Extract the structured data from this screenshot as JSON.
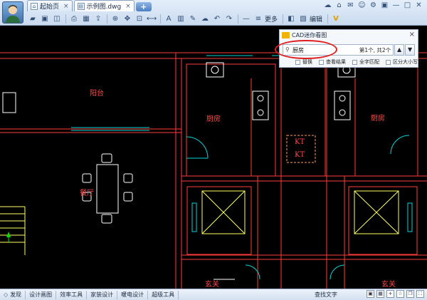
{
  "tabs": [
    {
      "label": "起始页",
      "active": false
    },
    {
      "label": "示例图.dwg",
      "active": true
    }
  ],
  "tab_add_label": "+",
  "window_controls": [
    "☁",
    "⌂",
    "✉",
    "☺",
    "⚙",
    "▣",
    "—",
    "□",
    "✕"
  ],
  "toolbar": {
    "more_label": "更多",
    "edit_label": "编辑"
  },
  "mini_viewer": {
    "title": "CAD迷你看图",
    "close": "×",
    "search_value": "厨房",
    "result_text": "第1个, 共2个",
    "nav_up": "▲",
    "nav_down": "▼",
    "options": [
      "替换",
      "查看结果",
      "全字匹配",
      "区分大小写"
    ]
  },
  "room_labels": {
    "balcony": "阳台",
    "kitchen_left": "厨房",
    "kitchen_right": "厨房",
    "dining": "餐厅",
    "kt_top": "KT",
    "kt_bottom": "KT",
    "entry_left": "玄关",
    "entry_right": "玄关"
  },
  "statusbar": {
    "items": [
      "发现",
      "设计画图",
      "效率工具",
      "家装设计",
      "暖电设计",
      "超级工具"
    ],
    "find_text": "查找文字"
  },
  "colors": {
    "wall": "#ff3a3a",
    "window": "#00d6d6",
    "furniture": "#ffffff",
    "text": "#ff4a4a",
    "elevator": "#ffff66"
  }
}
